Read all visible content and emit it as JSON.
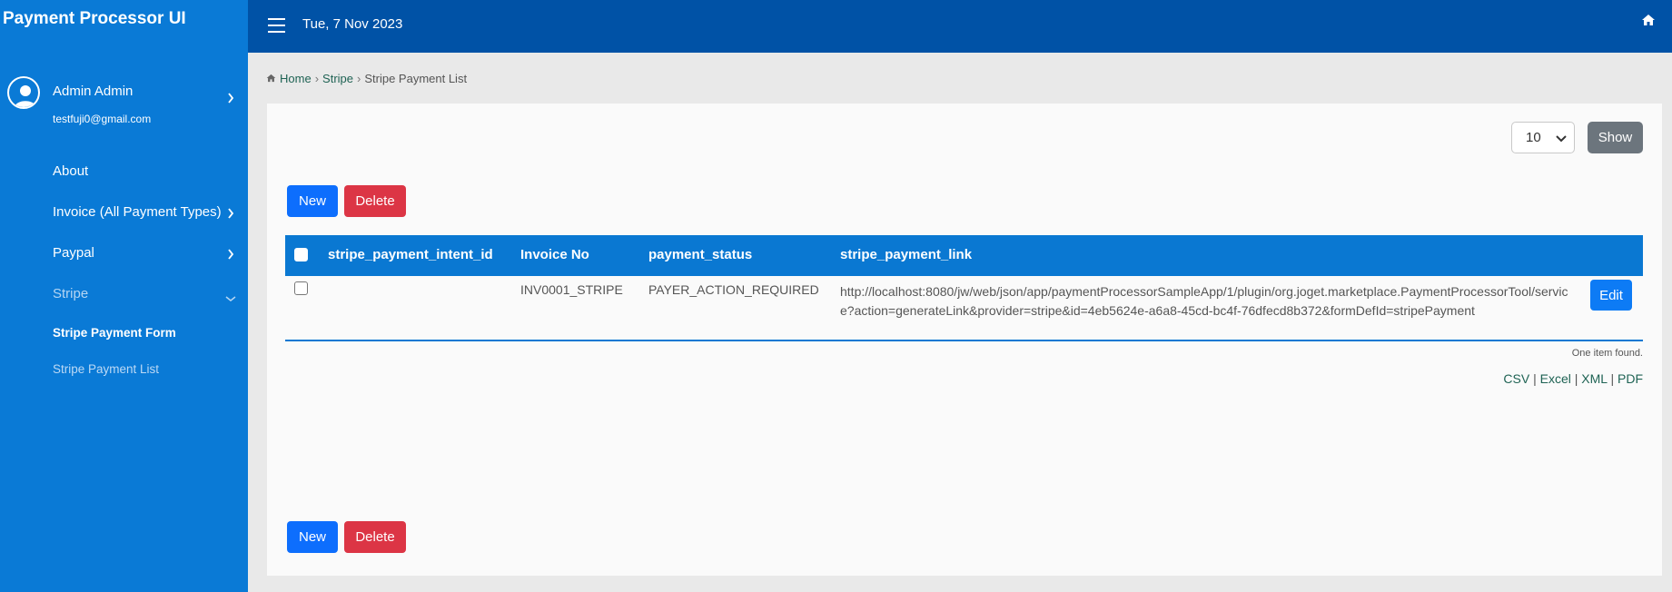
{
  "app": {
    "title": "Payment Processor UI"
  },
  "header": {
    "date": "Tue, 7 Nov 2023"
  },
  "profile": {
    "name": "Admin Admin",
    "email": "testfuji0@gmail.com"
  },
  "sidebar": {
    "items": [
      {
        "label": "About"
      },
      {
        "label": "Invoice (All Payment Types)"
      },
      {
        "label": "Paypal"
      },
      {
        "label": "Stripe"
      }
    ],
    "stripe_sub": [
      {
        "label": "Stripe Payment Form"
      },
      {
        "label": "Stripe Payment List"
      }
    ]
  },
  "breadcrumb": {
    "home": "Home",
    "section": "Stripe",
    "current": "Stripe Payment List"
  },
  "list": {
    "page_size": "10",
    "show_label": "Show",
    "new_label": "New",
    "delete_label": "Delete",
    "columns": [
      "stripe_payment_intent_id",
      "Invoice No",
      "payment_status",
      "stripe_payment_link"
    ],
    "rows": [
      {
        "stripe_payment_intent_id": "",
        "invoice_no": "INV0001_STRIPE",
        "payment_status": "PAYER_ACTION_REQUIRED",
        "stripe_payment_link": "http://localhost:8080/jw/web/json/app/paymentProcessorSampleApp/1/plugin/org.joget.marketplace.PaymentProcessorTool/service?action=generateLink&provider=stripe&id=4eb5624e-a6a8-45cd-bc4f-76dfecd8b372&formDefId=stripePayment",
        "edit_label": "Edit"
      }
    ],
    "found_text": "One item found.",
    "exports": [
      "CSV",
      "Excel",
      "XML",
      "PDF"
    ]
  },
  "colors": {
    "sidebar": "#0a7ad6",
    "topbar": "#0052a6",
    "table_header": "#0a78d2",
    "primary": "#0d6efd",
    "danger": "#dc3545",
    "secondary": "#6c757d"
  }
}
